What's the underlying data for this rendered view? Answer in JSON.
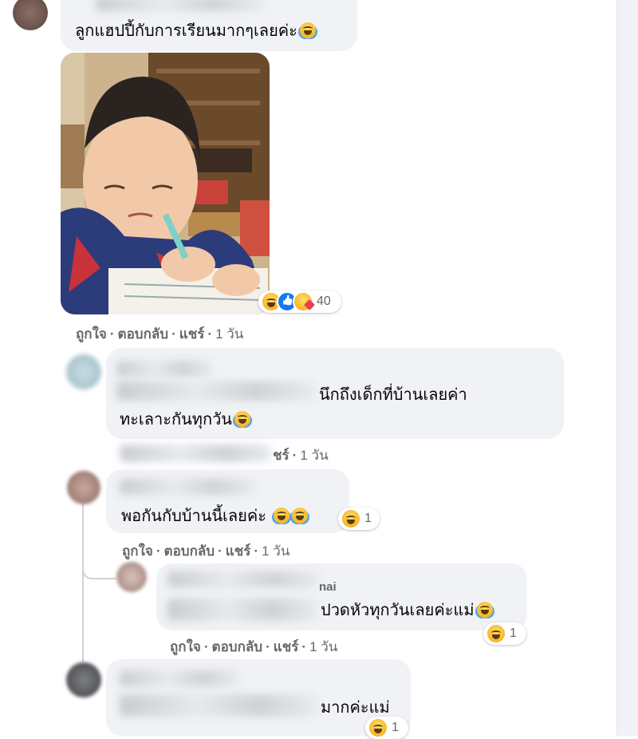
{
  "comments": [
    {
      "text": "ลูกแฮปปี้กับการเรียนมากๆเลยค่ะ",
      "photo_reactions": {
        "icons": [
          "haha-icon",
          "like-icon",
          "care-icon"
        ],
        "count": "40"
      },
      "actions": {
        "like": "ถูกใจ",
        "reply": "ตอบกลับ",
        "share": "แชร์",
        "time": "1 วัน"
      }
    },
    {
      "text_line1": "นึกถึงเด็กที่บ้านเลยค่า",
      "text_line2": "ทะเลาะกันทุกวัน",
      "actions": {
        "share": "ชร์",
        "time": "1 วัน"
      }
    },
    {
      "text": "พอกันกับบ้านนี้เลยค่ะ",
      "reactions": {
        "icons": [
          "haha-icon"
        ],
        "count": "1"
      },
      "actions": {
        "like": "ถูกใจ",
        "reply": "ตอบกลับ",
        "share": "แชร์",
        "time": "1 วัน"
      }
    },
    {
      "name_fragment": "nai",
      "text": "ปวดหัวทุกวันเลยค่ะแม่",
      "reactions": {
        "icons": [
          "haha-icon"
        ],
        "count": "1"
      },
      "actions": {
        "like": "ถูกใจ",
        "reply": "ตอบกลับ",
        "share": "แชร์",
        "time": "1 วัน"
      }
    },
    {
      "text": "มากค่ะแม่",
      "reactions": {
        "icons": [
          "haha-icon"
        ],
        "count": "1"
      }
    }
  ],
  "separator": "·"
}
